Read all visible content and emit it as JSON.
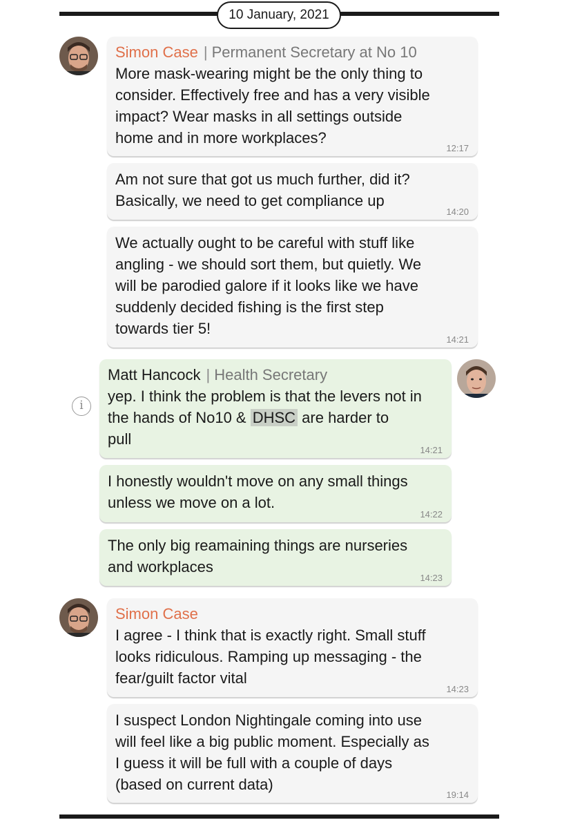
{
  "date": "10 January, 2021",
  "colors": {
    "case_name": "#e0704a",
    "left_bubble": "#f5f5f5",
    "right_bubble": "#e8f3e3",
    "highlight": "#c9cfc6"
  },
  "info_icon": "info-icon",
  "messages": [
    {
      "sender": "Simon Case",
      "role": "Permanent Secretary at No 10",
      "lines": [
        "More mask-wearing might be the only thing to",
        "consider. Effectively free and has a very visible",
        "impact? Wear masks in all settings outside",
        "home and in more workplaces?"
      ],
      "time": "12:17"
    },
    {
      "lines": [
        "Am not sure that got us much further, did it?",
        "Basically, we need to get compliance up"
      ],
      "time": "14:20"
    },
    {
      "lines": [
        "We actually ought to be careful with stuff like",
        "angling - we should sort them, but quietly. We",
        "will be parodied galore if it looks like we have",
        "suddenly decided fishing is the first step",
        "towards tier 5!"
      ],
      "time": "14:21"
    },
    {
      "sender": "Matt Hancock",
      "role": "Health Secretary",
      "lines": [
        "yep. I think the problem is that the levers not in",
        "the hands of No10 & ",
        "DHSC",
        " are harder to",
        "pull"
      ],
      "time": "14:21"
    },
    {
      "lines": [
        "I honestly wouldn't move on any small things",
        "unless we move on a lot."
      ],
      "time": "14:22"
    },
    {
      "lines": [
        "The only big reamaining things are nurseries",
        "and workplaces"
      ],
      "time": "14:23"
    },
    {
      "sender": "Simon Case",
      "lines": [
        "I agree - I think that is exactly right. Small stuff",
        "looks ridiculous. Ramping up messaging - the",
        "fear/guilt factor vital"
      ],
      "time": "14:23"
    },
    {
      "lines": [
        "I suspect London Nightingale coming into use",
        "will feel like a big public moment. Especially as",
        "I guess it will be full with a couple of days",
        "(based on current data)"
      ],
      "time": "19:14"
    }
  ]
}
